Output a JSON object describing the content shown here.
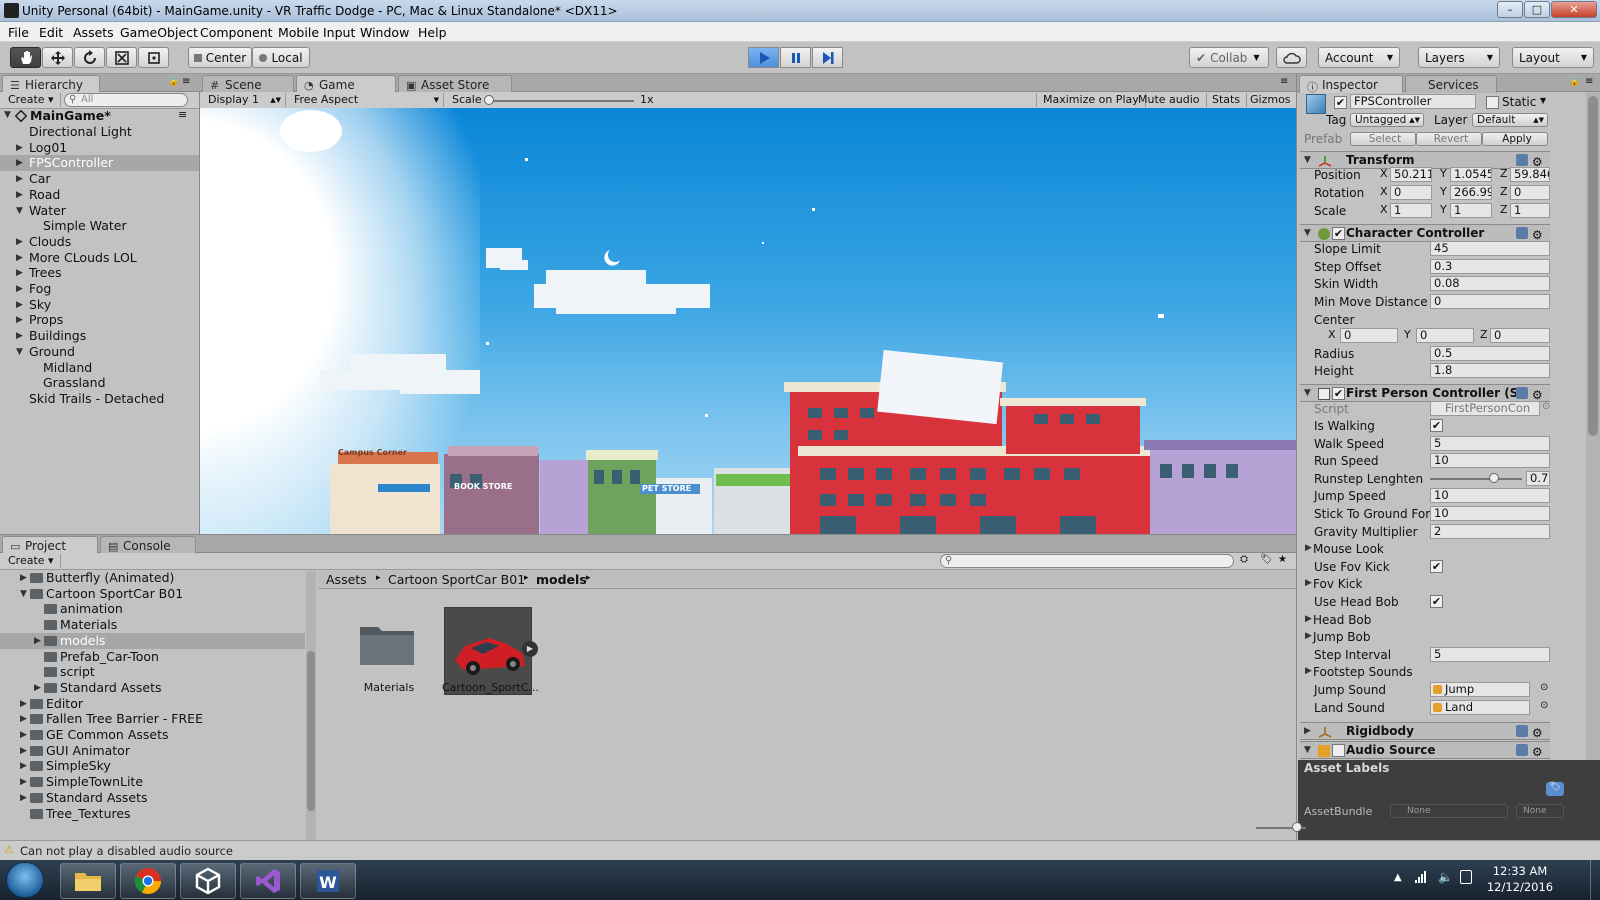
{
  "window": {
    "title": "Unity Personal (64bit) - MainGame.unity - VR Traffic Dodge - PC, Mac & Linux Standalone* <DX11>",
    "minimize": "–",
    "maximize": "□",
    "close": "✕"
  },
  "menu": [
    "File",
    "Edit",
    "Assets",
    "GameObject",
    "Component",
    "Mobile Input",
    "Window",
    "Help"
  ],
  "toolbar": {
    "pivot": "Center",
    "space": "Local",
    "collab": "Collab",
    "account": "Account",
    "layers": "Layers",
    "layout": "Layout",
    "icons": [
      "hand-tool-icon",
      "move-tool-icon",
      "rotate-tool-icon",
      "scale-tool-icon",
      "rect-tool-icon"
    ]
  },
  "hierarchy": {
    "tab": "Hierarchy",
    "create": "Create",
    "search_placeholder": "All",
    "scene": "MainGame*",
    "items": [
      {
        "label": "Directional Light",
        "depth": 1,
        "expand": ""
      },
      {
        "label": "Log01",
        "depth": 1,
        "expand": "▶"
      },
      {
        "label": "FPSController",
        "depth": 1,
        "expand": "▶",
        "selected": true
      },
      {
        "label": "Car",
        "depth": 1,
        "expand": "▶"
      },
      {
        "label": "Road",
        "depth": 1,
        "expand": "▶"
      },
      {
        "label": "Water",
        "depth": 1,
        "expand": "▼"
      },
      {
        "label": "Simple Water",
        "depth": 2,
        "expand": ""
      },
      {
        "label": "Clouds",
        "depth": 1,
        "expand": "▶"
      },
      {
        "label": "More CLouds LOL",
        "depth": 1,
        "expand": "▶"
      },
      {
        "label": "Trees",
        "depth": 1,
        "expand": "▶"
      },
      {
        "label": "Fog",
        "depth": 1,
        "expand": "▶"
      },
      {
        "label": "Sky",
        "depth": 1,
        "expand": "▶"
      },
      {
        "label": "Props",
        "depth": 1,
        "expand": "▶"
      },
      {
        "label": "Buildings",
        "depth": 1,
        "expand": "▶"
      },
      {
        "label": "Ground",
        "depth": 1,
        "expand": "▼"
      },
      {
        "label": "Midland",
        "depth": 2,
        "expand": ""
      },
      {
        "label": "Grassland",
        "depth": 2,
        "expand": ""
      },
      {
        "label": "Skid Trails - Detached",
        "depth": 1,
        "expand": ""
      }
    ]
  },
  "scene_tabs": [
    "Scene",
    "Game",
    "Asset Store"
  ],
  "game_bar": {
    "display": "Display 1",
    "aspect": "Free Aspect",
    "scale_label": "Scale",
    "scale_value": "1x",
    "maximize": "Maximize on Play",
    "mute": "Mute audio",
    "stats": "Stats",
    "gizmos": "Gizmos"
  },
  "game_view": {
    "signs": [
      "Campus Corner",
      "BOOK STORE",
      "PET STORE"
    ]
  },
  "project": {
    "tabs": [
      "Project",
      "Console"
    ],
    "create": "Create",
    "tree": [
      {
        "label": "Butterfly (Animated)",
        "depth": 1,
        "expand": "▶"
      },
      {
        "label": "Cartoon SportCar B01",
        "depth": 1,
        "expand": "▼"
      },
      {
        "label": "animation",
        "depth": 2,
        "expand": ""
      },
      {
        "label": "Materials",
        "depth": 2,
        "expand": ""
      },
      {
        "label": "models",
        "depth": 2,
        "expand": "▶",
        "selected": true
      },
      {
        "label": "Prefab_Car-Toon",
        "depth": 2,
        "expand": ""
      },
      {
        "label": "script",
        "depth": 2,
        "expand": ""
      },
      {
        "label": "Standard Assets",
        "depth": 2,
        "expand": "▶"
      },
      {
        "label": "Editor",
        "depth": 1,
        "expand": "▶"
      },
      {
        "label": "Fallen Tree Barrier - FREE",
        "depth": 1,
        "expand": "▶"
      },
      {
        "label": "GE Common Assets",
        "depth": 1,
        "expand": "▶"
      },
      {
        "label": "GUI Animator",
        "depth": 1,
        "expand": "▶"
      },
      {
        "label": "SimpleSky",
        "depth": 1,
        "expand": "▶"
      },
      {
        "label": "SimpleTownLite",
        "depth": 1,
        "expand": "▶"
      },
      {
        "label": "Standard Assets",
        "depth": 1,
        "expand": "▶"
      },
      {
        "label": "Tree_Textures",
        "depth": 1,
        "expand": ""
      }
    ],
    "breadcrumb": [
      "Assets",
      "Cartoon SportCar B01",
      "models"
    ],
    "assets": [
      "Materials",
      "Cartoon_SportC..."
    ]
  },
  "inspector": {
    "tabs": [
      "Inspector",
      "Services"
    ],
    "object_name": "FPSController",
    "static_label": "Static",
    "tag_label": "Tag",
    "tag_value": "Untagged",
    "layer_label": "Layer",
    "layer_value": "Default",
    "prefab_label": "Prefab",
    "prefab_select": "Select",
    "prefab_revert": "Revert",
    "prefab_apply": "Apply",
    "transform": {
      "title": "Transform",
      "position_label": "Position",
      "rotation_label": "Rotation",
      "scale_label": "Scale",
      "position": [
        "50.211",
        "1.0545",
        "59.846"
      ],
      "rotation": [
        "0",
        "266.99",
        "0"
      ],
      "scale": [
        "1",
        "1",
        "1"
      ]
    },
    "character_controller": {
      "title": "Character Controller",
      "rows": [
        {
          "label": "Slope Limit",
          "value": "45"
        },
        {
          "label": "Step Offset",
          "value": "0.3"
        },
        {
          "label": "Skin Width",
          "value": "0.08"
        },
        {
          "label": "Min Move Distance",
          "value": "0"
        }
      ],
      "center_label": "Center",
      "center": [
        "0",
        "0",
        "0"
      ],
      "radius_label": "Radius",
      "radius": "0.5",
      "height_label": "Height",
      "height": "1.8"
    },
    "fpc": {
      "title": "First Person Controller (Sc",
      "script_label": "Script",
      "script_value": "FirstPersonCon",
      "rows": [
        {
          "label": "Is Walking",
          "type": "check",
          "value": "✔"
        },
        {
          "label": "Walk Speed",
          "type": "field",
          "value": "5"
        },
        {
          "label": "Run Speed",
          "type": "field",
          "value": "10"
        },
        {
          "label": "Runstep Lenghten",
          "type": "slider",
          "value": "0.7",
          "fraction": 0.7
        },
        {
          "label": "Jump Speed",
          "type": "field",
          "value": "10"
        },
        {
          "label": "Stick To Ground Forc",
          "type": "field",
          "value": "10"
        },
        {
          "label": "Gravity Multiplier",
          "type": "field",
          "value": "2"
        },
        {
          "label": "Mouse Look",
          "type": "fold",
          "value": ""
        },
        {
          "label": "Use Fov Kick",
          "type": "check",
          "value": "✔"
        },
        {
          "label": "Fov Kick",
          "type": "fold",
          "value": ""
        },
        {
          "label": "Use Head Bob",
          "type": "check",
          "value": "✔"
        },
        {
          "label": "Head Bob",
          "type": "fold",
          "value": ""
        },
        {
          "label": "Jump Bob",
          "type": "fold",
          "value": ""
        },
        {
          "label": "Step Interval",
          "type": "field",
          "value": "5"
        },
        {
          "label": "Footstep Sounds",
          "type": "fold",
          "value": ""
        },
        {
          "label": "Jump Sound",
          "type": "object",
          "value": "Jump"
        },
        {
          "label": "Land Sound",
          "type": "object",
          "value": "Land"
        }
      ]
    },
    "rigidbody": "Rigidbody",
    "audio_source": "Audio Source",
    "asset_labels": "Asset Labels",
    "assetbundle_label": "AssetBundle",
    "assetbundle_value": "None",
    "assetbundle_variant": "None"
  },
  "status": "Can not play a disabled audio source",
  "taskbar": {
    "apps": [
      "file-explorer-icon",
      "chrome-icon",
      "unity-icon",
      "visual-studio-icon",
      "word-icon"
    ],
    "time": "12:33 AM",
    "date": "12/12/2016"
  }
}
